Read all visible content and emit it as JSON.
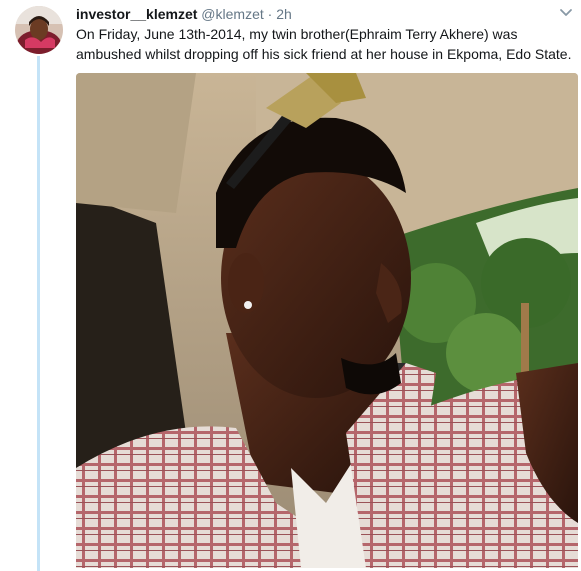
{
  "tweet": {
    "display_name": "investor__klemzet",
    "handle": "@klemzet",
    "separator": "·",
    "time": "2h",
    "text": "On Friday, June 13th-2014, my twin brother(Ephraim Terry Akhere) was ambushed whilst dropping off his sick friend at her house in Ekpoma, Edo State."
  },
  "icons": {
    "more": "chevron-down-icon"
  },
  "colors": {
    "thread_line": "#c4e3f7",
    "secondary_text": "#657786",
    "primary_text": "#14171a"
  }
}
